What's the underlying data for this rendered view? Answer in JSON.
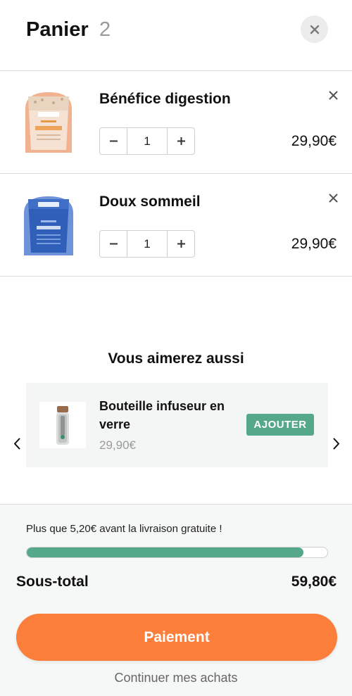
{
  "header": {
    "title": "Panier",
    "count": "2",
    "close_icon": "close-icon"
  },
  "cart": {
    "items": [
      {
        "name": "Bénéfice digestion",
        "quantity": "1",
        "price": "29,90€",
        "image": "peach-pouch-product-image",
        "decrement_icon": "minus-icon",
        "increment_icon": "plus-icon",
        "remove_icon": "close-icon"
      },
      {
        "name": "Doux sommeil",
        "quantity": "1",
        "price": "29,90€",
        "image": "blue-pouch-product-image",
        "decrement_icon": "minus-icon",
        "increment_icon": "plus-icon",
        "remove_icon": "close-icon"
      }
    ]
  },
  "recommendations": {
    "title": "Vous aimerez aussi",
    "prev_icon": "chevron-left-icon",
    "next_icon": "chevron-right-icon",
    "product": {
      "name": "Bouteille infuseur en verre",
      "price": "29,90€",
      "add_label": "AJOUTER",
      "image": "glass-bottle-image"
    }
  },
  "footer": {
    "shipping_message": "Plus que 5,20€ avant la livraison gratuite !",
    "shipping_progress": 0.92,
    "subtotal_label": "Sous-total",
    "subtotal_value": "59,80€",
    "checkout_label": "Paiement",
    "continue_label": "Continuer mes achats"
  },
  "colors": {
    "accent_green": "#55a88a",
    "checkout_orange": "#fb7f3b",
    "muted_text": "#9a9a9a"
  }
}
